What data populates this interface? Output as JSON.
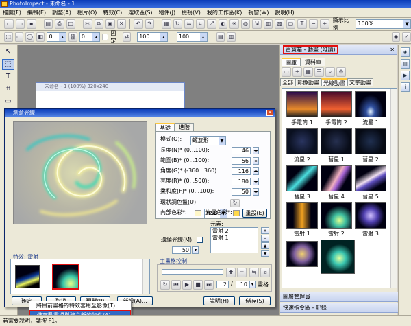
{
  "window": {
    "title": "PhotoImpact - 未命名 - 1"
  },
  "menu": [
    "檔案(F)",
    "編輯(E)",
    "調整(A)",
    "相片(O)",
    "特效(C)",
    "選取區(S)",
    "物件(J)",
    "檢視(V)",
    "我的工作區(K)",
    "視窗(W)",
    "說明(H)"
  ],
  "toolbar2": {
    "value1": "0",
    "value2": "0",
    "checkbox_label": "固定",
    "value3": "100",
    "value4": "100",
    "zoom_label": "顯示比例",
    "zoom_value": "100%"
  },
  "document": {
    "title": "未命名 - 1 (100%) 320x240"
  },
  "dialog": {
    "title": "創意光線",
    "tabs": [
      "基礎",
      "進階"
    ],
    "mode_label": "模式(O):",
    "mode_value": "螺旋形",
    "props": [
      {
        "label": "長度(N)* (0...100):",
        "value": "46"
      },
      {
        "label": "範圍(B)* (0...100):",
        "value": "56"
      },
      {
        "label": "角度(G)* (-360...360):",
        "value": "116"
      },
      {
        "label": "亮度(R)* (0...500):",
        "value": "180"
      },
      {
        "label": "柔和度(F)* (0...100):",
        "value": "50"
      }
    ],
    "ring_label": "環狀調色盤(U):",
    "ring_value": "HSB",
    "inner_color_label": "內部色彩*:",
    "light_color_label": "光暈色彩*:",
    "reset_button": "重設(E)",
    "elements_label": "元素:",
    "elements": [
      "雷射 2",
      "雷射 1"
    ],
    "ring_ray_label": "環繞光線(M)",
    "ring_ray_value": "50",
    "effect_label": "特效: 雷射",
    "keyframe_label": "主畫格控制",
    "frame_current": "2",
    "frame_total": "10",
    "frame_unit": "畫格",
    "buttons": {
      "ok": "確定",
      "cancel": "取消",
      "preview": "預覽(P)",
      "add": "新增(A)...",
      "help": "說明(H)",
      "save": "儲存(S)"
    }
  },
  "context_menu": {
    "items": [
      "將目前畫格的特效套用至影像(T)",
      "儲存動畫檔與建立新的物件(A)..."
    ]
  },
  "right_panel": {
    "title": "百寶箱 - 動畫 (唯讀)",
    "tabs": [
      "圖庫",
      "資料庫"
    ],
    "subtabs": [
      "全部",
      "影像動畫",
      "光線動畫",
      "文字動畫"
    ],
    "items": [
      {
        "label": "手電筒 1"
      },
      {
        "label": "手電筒 2"
      },
      {
        "label": "流星 1"
      },
      {
        "label": "流星 2"
      },
      {
        "label": "彗星 1"
      },
      {
        "label": "彗星 2"
      },
      {
        "label": "彗星 3"
      },
      {
        "label": "彗星 4"
      },
      {
        "label": "彗星 5"
      },
      {
        "label": "雷射 1"
      },
      {
        "label": "雷射 2"
      },
      {
        "label": "雷射 3"
      }
    ],
    "bottom_items": [
      "圖層管理員",
      "快速指令區 - 記錄"
    ]
  },
  "status": {
    "text": "若需要說明，請按 F1。"
  }
}
